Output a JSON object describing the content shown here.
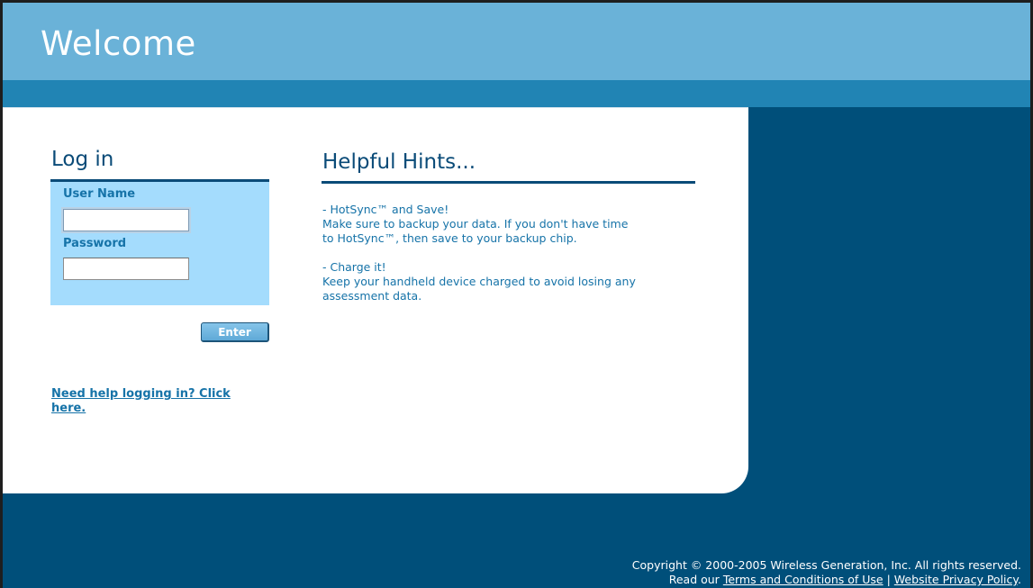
{
  "header": {
    "title": "Welcome"
  },
  "login": {
    "heading": "Log in",
    "username_label": "User Name",
    "username_value": "",
    "password_label": "Password",
    "password_value": "",
    "enter_button": "Enter",
    "help_link": "Need help logging in? Click here."
  },
  "hints": {
    "heading": "Helpful Hints...",
    "items": [
      {
        "title": "- HotSync™ and Save!",
        "lines": [
          "Make sure to backup your data. If you don't have time",
          "to HotSync™, then save to your backup chip."
        ]
      },
      {
        "title": "- Charge it!",
        "lines": [
          "Keep your handheld device charged to avoid losing any",
          "assessment data."
        ]
      }
    ]
  },
  "footer": {
    "copyright": "Copyright © 2000-2005 Wireless Generation, Inc. All rights reserved.",
    "read_our": "Read our",
    "terms_link": "Terms and Conditions of Use",
    "separator": "|",
    "privacy_link": "Website Privacy Policy",
    "period": "."
  },
  "colors": {
    "header_light": "#6ab2d8",
    "header_band": "#2184b4",
    "dark_blue": "#004f7a",
    "login_box": "#a4dcfd",
    "heading_text": "#0a4b78",
    "body_text": "#1673a8"
  }
}
